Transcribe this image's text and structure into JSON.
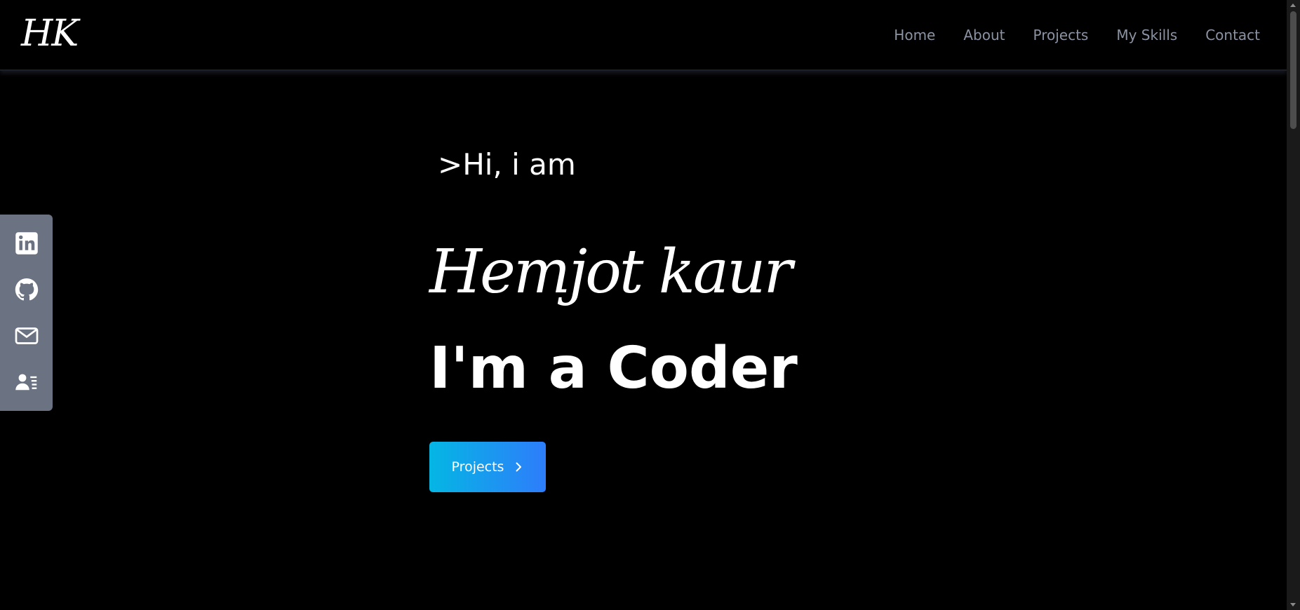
{
  "header": {
    "logo": "HK",
    "nav": [
      {
        "label": "Home"
      },
      {
        "label": "About"
      },
      {
        "label": "Projects"
      },
      {
        "label": "My Skills"
      },
      {
        "label": "Contact"
      }
    ]
  },
  "social": {
    "items": [
      {
        "icon": "linkedin-icon"
      },
      {
        "icon": "github-icon"
      },
      {
        "icon": "mail-icon"
      },
      {
        "icon": "contact-card-icon"
      }
    ]
  },
  "hero": {
    "greeting": ">Hi, i am",
    "name": "Hemjot kaur",
    "role": "I'm a Coder",
    "cta_label": "Projects"
  },
  "colors": {
    "background": "#000000",
    "nav_text": "#8b93a3",
    "social_bar": "#6b7281",
    "cta_gradient_start": "#04b6e4",
    "cta_gradient_end": "#2e7dfb"
  }
}
